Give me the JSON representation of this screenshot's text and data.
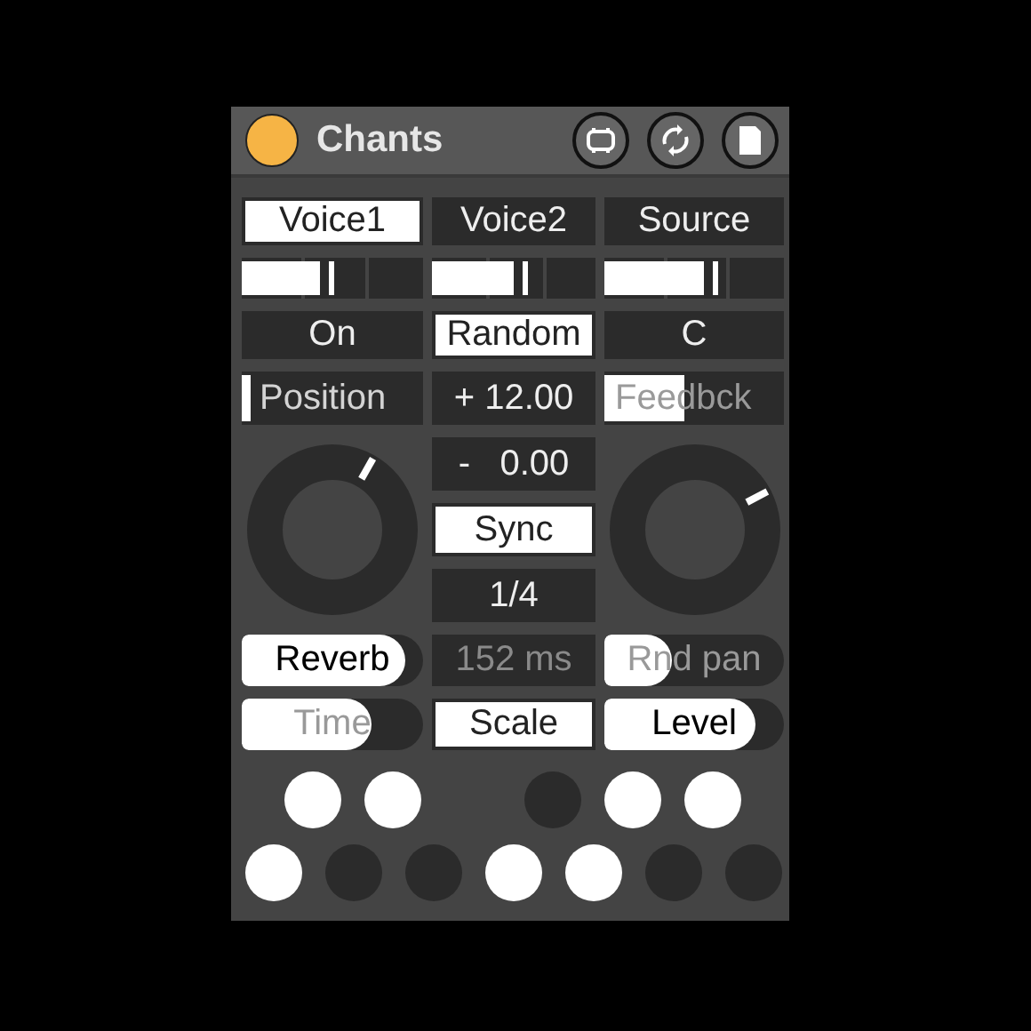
{
  "header": {
    "title": "Chants",
    "power_on": true
  },
  "tabs": [
    {
      "label": "Voice1",
      "selected": true
    },
    {
      "label": "Voice2",
      "selected": false
    },
    {
      "label": "Source",
      "selected": false
    }
  ],
  "sliders": [
    {
      "level": 0.43
    },
    {
      "level": 0.5
    },
    {
      "level": 0.55
    }
  ],
  "modes": [
    {
      "label": "On",
      "selected": false
    },
    {
      "label": "Random",
      "selected": true
    },
    {
      "label": "C",
      "selected": false
    }
  ],
  "position": {
    "label": "Position",
    "level": 0.05,
    "dimmed": false
  },
  "transpose": "+ 12.00",
  "feedback": {
    "label": "Feedbck",
    "level": 0.45,
    "dimmed": true
  },
  "offset": "-   0.00",
  "sync": {
    "label": "Sync",
    "selected": true
  },
  "division": "1/4",
  "reverb": {
    "label": "Reverb",
    "level": 0.9,
    "dimmed": false
  },
  "delay_time": {
    "text": "152 ms",
    "disabled": true
  },
  "rnd_pan": {
    "label": "Rnd pan",
    "level": 0.38,
    "dimmed": true
  },
  "time": {
    "label": "Time",
    "level": 0.72,
    "dimmed": true
  },
  "scale": {
    "label": "Scale",
    "selected": true
  },
  "level": {
    "label": "Level",
    "level": 0.84,
    "dimmed": false
  },
  "dots": [
    [
      {
        "kind": "dot",
        "on": true
      },
      {
        "kind": "dot",
        "on": true
      },
      {
        "kind": "gap"
      },
      {
        "kind": "dot",
        "on": false
      },
      {
        "kind": "dot",
        "on": true
      },
      {
        "kind": "dot",
        "on": true
      }
    ],
    [
      {
        "kind": "dot",
        "on": true
      },
      {
        "kind": "dot",
        "on": false
      },
      {
        "kind": "dot",
        "on": false
      },
      {
        "kind": "dot",
        "on": true
      },
      {
        "kind": "dot",
        "on": true
      },
      {
        "kind": "dot",
        "on": false
      },
      {
        "kind": "dot",
        "on": false
      }
    ]
  ]
}
